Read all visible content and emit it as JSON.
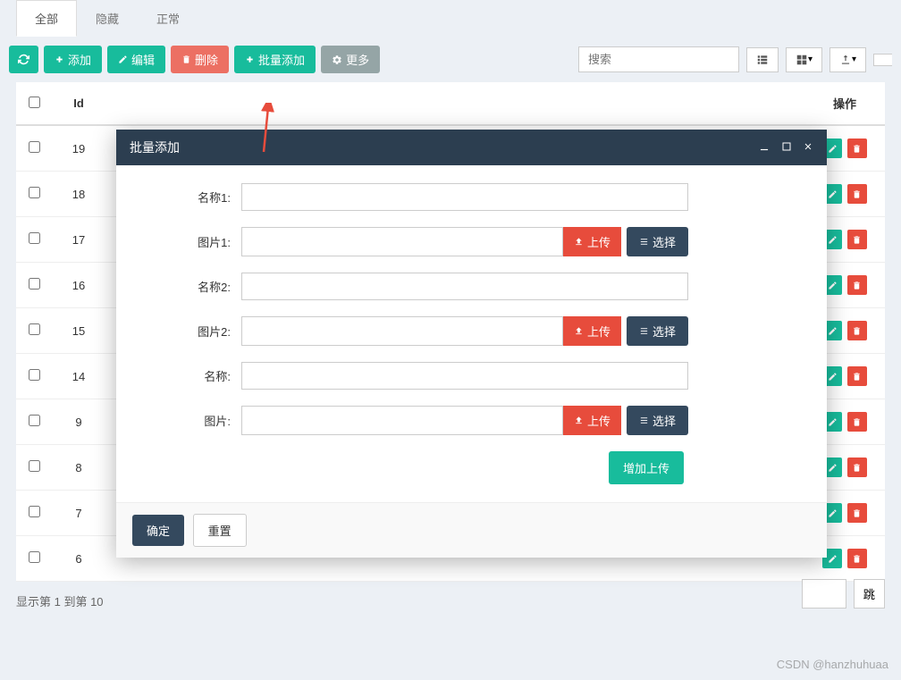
{
  "tabs": [
    {
      "label": "全部",
      "active": true
    },
    {
      "label": "隐藏",
      "active": false
    },
    {
      "label": "正常",
      "active": false
    }
  ],
  "toolbar": {
    "add_label": "添加",
    "edit_label": "编辑",
    "delete_label": "删除",
    "batch_add_label": "批量添加",
    "more_label": "更多",
    "search_placeholder": "搜索"
  },
  "table": {
    "headers": {
      "id": "Id",
      "op": "操作"
    },
    "rows": [
      {
        "id": "19"
      },
      {
        "id": "18"
      },
      {
        "id": "17"
      },
      {
        "id": "16"
      },
      {
        "id": "15"
      },
      {
        "id": "14"
      },
      {
        "id": "9"
      },
      {
        "id": "8"
      },
      {
        "id": "7"
      },
      {
        "id": "6"
      }
    ],
    "pagination_info": "显示第 1 到第 10",
    "jump_label": "跳"
  },
  "modal": {
    "title": "批量添加",
    "fields": [
      {
        "label": "名称1:",
        "type": "text"
      },
      {
        "label": "图片1:",
        "type": "upload"
      },
      {
        "label": "名称2:",
        "type": "text"
      },
      {
        "label": "图片2:",
        "type": "upload"
      },
      {
        "label": "名称:",
        "type": "text"
      },
      {
        "label": "图片:",
        "type": "upload"
      }
    ],
    "upload_btn": "上传",
    "select_btn": "选择",
    "add_upload_btn": "增加上传",
    "confirm_btn": "确定",
    "reset_btn": "重置"
  },
  "watermark": "CSDN @hanzhuhuaa"
}
